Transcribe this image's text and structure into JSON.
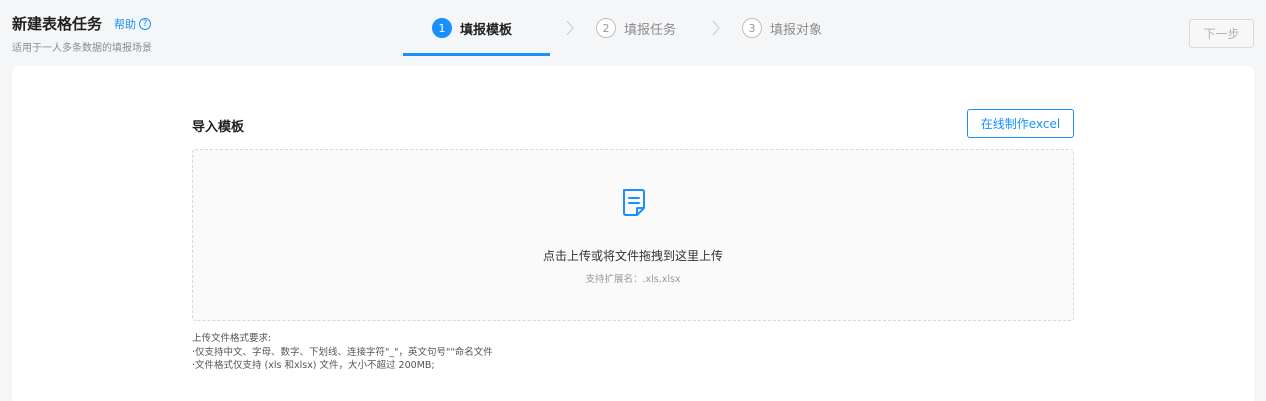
{
  "header": {
    "title": "新建表格任务",
    "help_label": "帮助",
    "help_icon": "?",
    "subtitle": "适用于一人多条数据的填报场景"
  },
  "steps": [
    {
      "num": "1",
      "label": "填报模板",
      "active": true
    },
    {
      "num": "2",
      "label": "填报任务",
      "active": false
    },
    {
      "num": "3",
      "label": "填报对象",
      "active": false
    }
  ],
  "next_button": "下一步",
  "import": {
    "title": "导入模板",
    "excel_button": "在线制作excel",
    "drop_main": "点击上传或将文件拖拽到这里上传",
    "drop_sub": "支持扩展名：.xls,xlsx"
  },
  "requirements": [
    "上传文件格式要求:",
    "·仅支持中文、字母、数字、下划线、连接字符\"_\"，英文句号\"\"命名文件",
    "·文件格式仅支持 (xls 和xlsx) 文件，大小不超过 200MB;"
  ],
  "colors": {
    "accent": "#1890ff",
    "border": "#d9d9d9",
    "background": "#f5f6f8"
  },
  "icons": {
    "help": "question-circle-icon",
    "step_separator": "chevron-right-icon",
    "upload": "document-icon"
  }
}
